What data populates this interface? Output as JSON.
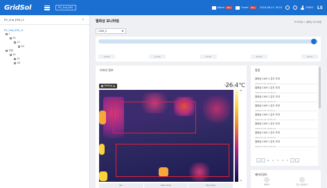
{
  "header": {
    "logo": "GridSol",
    "site_select": "PV_2nd_ESS",
    "alarm_label": "Alarm",
    "alarm_count": "99+",
    "event_label": "Event",
    "event_count": "99+",
    "datetime": "2024-06-11  16:22",
    "user": "ESSE1",
    "logout": "LS"
  },
  "sidebar": {
    "title": "PV_2nd_ESS_r1",
    "subtitle": "PV_2nd_ESS_r1",
    "tree": [
      {
        "label": "C"
      },
      {
        "label": "B1"
      },
      {
        "label": "A1"
      },
      {
        "label": "A4"
      },
      {
        "label": "전열"
      },
      {
        "label": "B1"
      },
      {
        "label": "S1"
      },
      {
        "label": "A8"
      }
    ]
  },
  "main": {
    "title": "열화상 모니터링",
    "breadcrumb": "모니터링 > 열화상 모니터링",
    "camera_select": "CAM_2"
  },
  "timeline": {
    "labels": [
      "10:00",
      "12:00",
      "14:00",
      "16:00",
      "16:22"
    ],
    "position_pct": 98
  },
  "image_panel": {
    "title": "이미지 정보",
    "setting_button": "Setting",
    "temp_label": "Temperature",
    "temp_value": "26.4℃",
    "scale_max": "36",
    "scale_min": "18",
    "table_headers": [
      "No.",
      "Max temp",
      "Min temp"
    ]
  },
  "alarms": {
    "title": "알람",
    "items": [
      {
        "text": "열화상 CAM 1 온도 초과",
        "time": "2024-07-15 14:57:19"
      },
      {
        "text": "열화상 CAM 1 온도 초과",
        "time": "2024-07-15 14:38:51"
      },
      {
        "text": "열화상 CAM 1 온도 초과",
        "time": "2024-07-15 14:29:30"
      },
      {
        "text": "열화상 CAM 1 온도 초과",
        "time": "2024-07-15 14:19:11"
      },
      {
        "text": "열화상 CAM 1 온도 초과",
        "time": "2024-07-15 14:05:24"
      },
      {
        "text": "열화상 CAM 1 온도 초과",
        "time": "2024-07-15 14:00:29"
      },
      {
        "text": "열화상 CAM 1 온도 초과",
        "time": "2024-07-15 13:45:22"
      },
      {
        "text": "열화상 CAM 1 온도 초과",
        "time": "2024-07-15 13:30:12"
      }
    ],
    "pager": {
      "first": "«",
      "prev": "‹",
      "pages": [
        "1",
        "2",
        "3",
        "4",
        "5"
      ],
      "next": "›",
      "last": "»"
    }
  },
  "info": {
    "title": "배터리정보",
    "items": [
      {
        "label": "배터리"
      },
      {
        "label": "온도 이상감지"
      }
    ]
  },
  "colors": {
    "brand": "#1b6fd1",
    "alarm_badge": "#e74c3c",
    "roi": "#e0213a"
  }
}
